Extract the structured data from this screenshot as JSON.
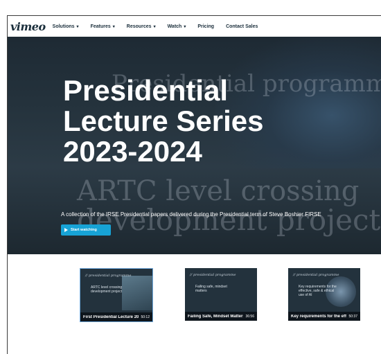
{
  "nav": {
    "logo": "vimeo",
    "items": [
      "Solutions",
      "Features",
      "Resources",
      "Watch",
      "Pricing",
      "Contact Sales"
    ]
  },
  "hero": {
    "title_lines": [
      "Presidential",
      "Lecture Series",
      "2023-2024"
    ],
    "ghost_lines": [
      "Presidential programme",
      "ARTC level crossing",
      "development project"
    ],
    "subtitle": "A collection of the IRSE Presidential papers delivered during the Presidential term of Steve Boshier FIRSE",
    "watch_button": "Start watching",
    "accent_color": "#17a3d6"
  },
  "cards": [
    {
      "brand": "// presidential programme",
      "headline": "ARTC level crossing development project",
      "title": "First Presidential Lecture 20...",
      "duration": "50:12"
    },
    {
      "brand": "// presidential programme",
      "headline": "Failing safe, mindset matters",
      "title": "Failing Safe, Mindset Matters",
      "duration": "36:56"
    },
    {
      "brand": "// presidential programme",
      "headline": "Key requirements for the effective, safe & ethical use of AI",
      "title": "Key requirements for the eff...",
      "duration": "50:37"
    }
  ]
}
